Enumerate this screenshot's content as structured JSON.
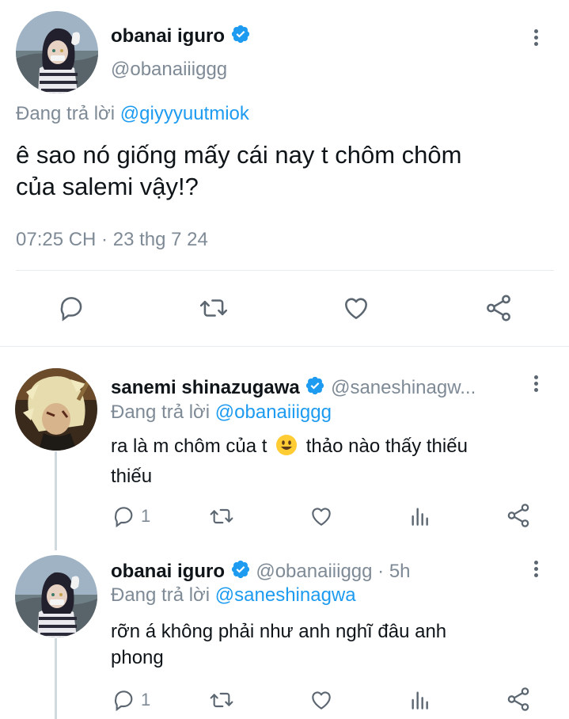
{
  "main_tweet": {
    "display_name": "obanai iguro",
    "handle": "@obanaiiiggg",
    "replying_prefix": "Đang trả lời",
    "replying_to": "@giyyyuutmiok",
    "text_line1": "ê sao nó giống mấy cái nay t chôm chôm",
    "text_line2": "của salemi vậy!?",
    "timestamp": "07:25 CH · 23 thg 7 24"
  },
  "replies": [
    {
      "display_name": "sanemi shinazugawa",
      "handle": "@saneshinagw...",
      "replying_prefix": "Đang trả lời",
      "replying_to": "@obanaiiiggg",
      "text_before_emoji": "ra là m chôm của t",
      "emoji": "smiley-face",
      "text_after_emoji": "thảo nào thấy thiếu",
      "text_line2": "thiếu",
      "reply_count": "1"
    },
    {
      "display_name": "obanai iguro",
      "handle": "@obanaiiiggg",
      "time": "· 5h",
      "replying_prefix": "Đang trả lời",
      "replying_to": "@saneshinagwa",
      "text_line1": "rỡn á không phải như anh nghĩ đâu anh",
      "text_line2": "phong",
      "reply_count": "1"
    }
  ],
  "icons": {
    "reply": "speech-bubble-icon",
    "retweet": "retweet-icon",
    "like": "heart-icon",
    "views": "bar-chart-icon",
    "share": "share-icon",
    "more": "more-vertical-icon",
    "verified": "verified-badge-icon"
  },
  "colors": {
    "accent": "#1d9bf0",
    "muted": "#7e8a96",
    "text": "#0f1419",
    "divider": "#e6ecf0"
  }
}
